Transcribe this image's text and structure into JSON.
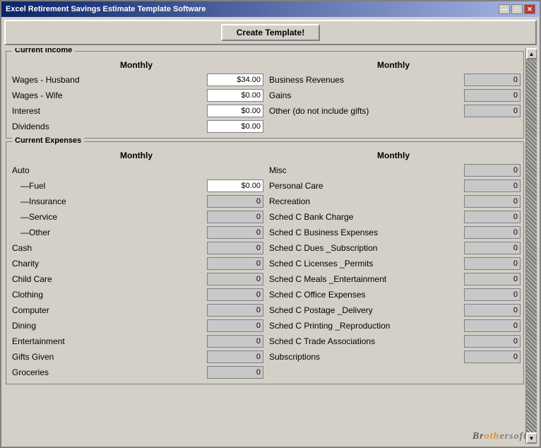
{
  "window": {
    "title": "Excel Retirement Savings Estimate Template Software",
    "controls": {
      "minimize": "—",
      "maximize": "□",
      "close": "✕"
    }
  },
  "toolbar": {
    "create_label": "Create Template!"
  },
  "income_section": {
    "title": "Current Income",
    "left_header": "Monthly",
    "right_header": "Monthly",
    "left_rows": [
      {
        "label": "Wages - Husband",
        "value": "$34.00"
      },
      {
        "label": "Wages - Wife",
        "value": "$0.00"
      },
      {
        "label": "Interest",
        "value": "$0.00"
      },
      {
        "label": "Dividends",
        "value": "$0.00"
      }
    ],
    "right_rows": [
      {
        "label": "Business Revenues",
        "value": "0"
      },
      {
        "label": "Gains",
        "value": "0"
      },
      {
        "label": "Other (do not include gifts)",
        "value": "0"
      }
    ]
  },
  "expenses_section": {
    "title": "Current Expenses",
    "left_header": "Monthly",
    "right_header": "Monthly",
    "left_rows": [
      {
        "label": "Auto",
        "value": "",
        "indent": 0,
        "no_input": true
      },
      {
        "label": "—Fuel",
        "value": "$0.00",
        "indent": 1
      },
      {
        "label": "—Insurance",
        "value": "0",
        "indent": 1
      },
      {
        "label": "—Service",
        "value": "0",
        "indent": 1
      },
      {
        "label": "—Other",
        "value": "0",
        "indent": 1
      },
      {
        "label": "Cash",
        "value": "0",
        "indent": 0
      },
      {
        "label": "Charity",
        "value": "0",
        "indent": 0
      },
      {
        "label": "Child Care",
        "value": "0",
        "indent": 0
      },
      {
        "label": "Clothing",
        "value": "0",
        "indent": 0
      },
      {
        "label": "Computer",
        "value": "0",
        "indent": 0
      },
      {
        "label": "Dining",
        "value": "0",
        "indent": 0
      },
      {
        "label": "Entertainment",
        "value": "0",
        "indent": 0
      },
      {
        "label": "Gifts Given",
        "value": "0",
        "indent": 0
      },
      {
        "label": "Groceries",
        "value": "0",
        "indent": 0
      }
    ],
    "right_rows": [
      {
        "label": "Misc",
        "value": "0"
      },
      {
        "label": "Personal Care",
        "value": "0"
      },
      {
        "label": "Recreation",
        "value": "0"
      },
      {
        "label": "Sched C Bank Charge",
        "value": "0"
      },
      {
        "label": "Sched C Business Expenses",
        "value": "0"
      },
      {
        "label": "Sched C Dues _Subscription",
        "value": "0"
      },
      {
        "label": "Sched C Licenses _Permits",
        "value": "0"
      },
      {
        "label": "Sched C Meals _Entertainment",
        "value": "0"
      },
      {
        "label": "Sched C Office Expenses",
        "value": "0"
      },
      {
        "label": "Sched C Postage _Delivery",
        "value": "0"
      },
      {
        "label": "Sched C Printing _Reproduction",
        "value": "0"
      },
      {
        "label": "Sched C Trade Associations",
        "value": "0"
      },
      {
        "label": "Subscriptions",
        "value": "0"
      }
    ]
  },
  "watermark": {
    "text1": "Br",
    "text2": "oth",
    "text3": "ersoft"
  }
}
